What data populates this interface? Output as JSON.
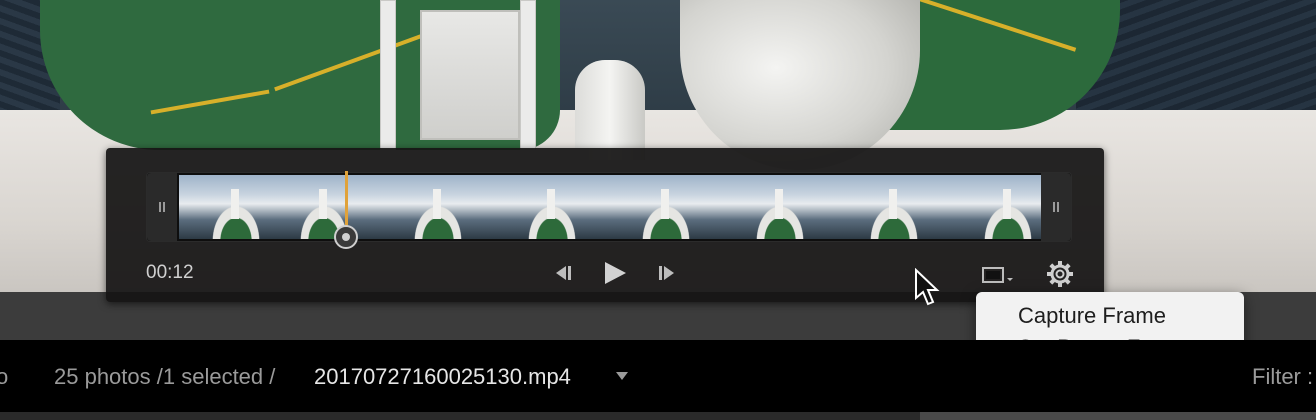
{
  "player": {
    "timecode": "00:12",
    "controls": {
      "prev_frame_icon": "step-back-icon",
      "play_icon": "play-icon",
      "next_frame_icon": "step-forward-icon",
      "frame_icon": "frame-capture-icon",
      "settings_icon": "gear-icon"
    },
    "thumbnail_count": 8,
    "playhead_color": "#e0a23a"
  },
  "frame_menu": {
    "items": [
      {
        "label": "Capture Frame"
      },
      {
        "label": "Set Poster Frame"
      }
    ]
  },
  "status_bar": {
    "partial_left": "o",
    "count": "25 photos /1 selected /",
    "filename": "20170727160025130.mp4",
    "filter_label": "Filter :"
  }
}
